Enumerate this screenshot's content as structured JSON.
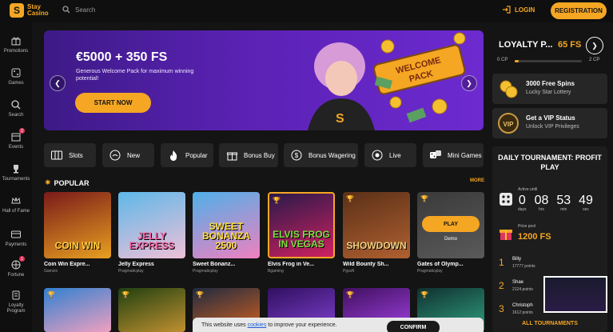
{
  "header": {
    "logo_line1": "Stay",
    "logo_line2": "Casino",
    "search_placeholder": "Search",
    "login_label": "LOGIN",
    "register_label": "REGISTRATION"
  },
  "sidebar": {
    "items": [
      {
        "label": "Promotions",
        "icon": "gift-icon"
      },
      {
        "label": "Games",
        "icon": "dice-icon"
      },
      {
        "label": "Search",
        "icon": "search-icon"
      },
      {
        "label": "Events",
        "icon": "calendar-icon"
      },
      {
        "label": "Tournaments",
        "icon": "trophy-icon"
      },
      {
        "label": "Hall of Fame",
        "icon": "crown-icon"
      },
      {
        "label": "Payments",
        "icon": "card-icon"
      },
      {
        "label": "Fortune",
        "icon": "wheel-icon"
      },
      {
        "label": "Loyalty Program",
        "icon": "medal-icon"
      }
    ]
  },
  "banner": {
    "title": "€5000 + 350 FS",
    "subtitle": "Generous Welcome Pack for maximum winning potential!",
    "cta": "START NOW",
    "sign": "WELCOME PACK"
  },
  "categories": [
    {
      "label": "Slots",
      "icon": "slots-icon"
    },
    {
      "label": "New",
      "icon": "new-icon"
    },
    {
      "label": "Popular",
      "icon": "fire-icon"
    },
    {
      "label": "Bonus Buy",
      "icon": "gift-box-icon"
    },
    {
      "label": "Bonus Wagering",
      "icon": "wagering-icon"
    },
    {
      "label": "Live",
      "icon": "live-icon"
    },
    {
      "label": "Mini Games",
      "icon": "mini-dice-icon"
    }
  ],
  "popular": {
    "title": "POPULAR",
    "more": "MORE",
    "games": [
      {
        "name": "Coin Win Expre...",
        "provider": "Gamzix",
        "art": "COIN WIN",
        "color1": "#7a1a1a",
        "color2": "#e8a020"
      },
      {
        "name": "Jelly Express",
        "provider": "Pragmaticplay",
        "art": "JELLY EXPRESS",
        "color1": "#5db8e8",
        "color2": "#f0c0d8"
      },
      {
        "name": "Sweet Bonanz...",
        "provider": "Pragmaticplay",
        "art": "SWEET BONANZA 2500",
        "color1": "#4fb0e8",
        "color2": "#f080c0"
      },
      {
        "name": "Elvis Frog in Ve...",
        "provider": "Bgaming",
        "art": "ELVIS FROG IN VEGAS",
        "color1": "#2a1a4a",
        "color2": "#d02060"
      },
      {
        "name": "Wild Bounty Sh...",
        "provider": "Pgsoft",
        "art": "SHOWDOWN",
        "color1": "#5a3018",
        "color2": "#b06030"
      },
      {
        "name": "Gates of Olymp...",
        "provider": "Pragmaticplay",
        "art": "",
        "color1": "#3a3a3a",
        "color2": "#5a5a5a"
      }
    ],
    "play_label": "PLAY",
    "demo_label": "Demo"
  },
  "loyalty": {
    "title": "LOYALTY P...",
    "percent": "65 FS",
    "cp_left": "0 CP",
    "cp_right": "2 CP",
    "progress": 0.05
  },
  "perks": [
    {
      "title": "3000 Free Spins",
      "sub": "Lucky Star Lottery"
    },
    {
      "title": "Get a VIP Status",
      "sub": "Unlock VIP Privileges"
    }
  ],
  "tournament": {
    "title": "DAILY TOURNAMENT: PROFIT PLAY",
    "active_label": "Active until",
    "timer": [
      {
        "num": "0",
        "unit": "days"
      },
      {
        "num": "08",
        "unit": "hrs"
      },
      {
        "num": "53",
        "unit": "min"
      },
      {
        "num": "49",
        "unit": "sec"
      }
    ],
    "prize_label": "Prize pool",
    "prize": "1200 FS",
    "leaders": [
      {
        "rank": "1",
        "name": "Billy",
        "points": "17777 points"
      },
      {
        "rank": "2",
        "name": "Shae",
        "points": "2124 points"
      },
      {
        "rank": "3",
        "name": "Christoph",
        "points": "1612 points"
      }
    ],
    "all": "ALL TOURNAMENTS"
  },
  "cookie": {
    "text_before": "This website uses ",
    "link": "cookies",
    "text_after": " to improve your experience.",
    "confirm": "CONFIRM"
  },
  "colors": {
    "accent": "#f5a623",
    "bg": "#141414",
    "panel": "#262626",
    "banner": "#5a22b4"
  }
}
